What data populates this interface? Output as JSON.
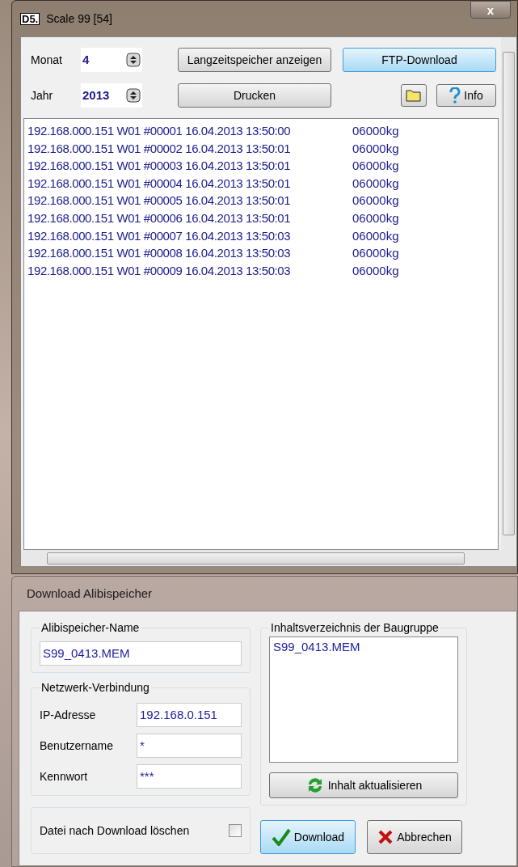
{
  "main_window": {
    "title": "Scale 99 [54]",
    "logo": "D5.",
    "close": "x",
    "month": {
      "label": "Monat",
      "value": "4"
    },
    "year": {
      "label": "Jahr",
      "value": "2013"
    },
    "buttons": [
      {
        "label": "Langzeitspeicher anzeigen",
        "selected": false
      },
      {
        "label": "FTP-Download",
        "selected": true
      },
      {
        "label": "Drucken",
        "selected": false
      }
    ],
    "info_button": "Info",
    "records": [
      {
        "line": "192.168.000.151 W01 #00001 16.04.2013 13:50:00",
        "weight": "06000kg"
      },
      {
        "line": "192.168.000.151 W01 #00002 16.04.2013 13:50:01",
        "weight": "06000kg"
      },
      {
        "line": "192.168.000.151 W01 #00003 16.04.2013 13:50:01",
        "weight": "06000kg"
      },
      {
        "line": "192.168.000.151 W01 #00004 16.04.2013 13:50:01",
        "weight": "06000kg"
      },
      {
        "line": "192.168.000.151 W01 #00005 16.04.2013 13:50:01",
        "weight": "06000kg"
      },
      {
        "line": "192.168.000.151 W01 #00006 16.04.2013 13:50:01",
        "weight": "06000kg"
      },
      {
        "line": "192.168.000.151 W01 #00007 16.04.2013 13:50:03",
        "weight": "06000kg"
      },
      {
        "line": "192.168.000.151 W01 #00008 16.04.2013 13:50:03",
        "weight": "06000kg"
      },
      {
        "line": "192.168.000.151 W01 #00009 16.04.2013 13:50:03",
        "weight": "06000kg"
      }
    ]
  },
  "download_window": {
    "title": "Download Alibispeicher",
    "name_group": {
      "title": "Alibispeicher-Name",
      "value": "S99_0413.MEM"
    },
    "network_group": {
      "title": "Netzwerk-Verbindung",
      "fields": [
        {
          "label": "IP-Adresse",
          "value": "192.168.0.151"
        },
        {
          "label": "Benutzername",
          "value": "*"
        },
        {
          "label": "Kennwort",
          "value": "***"
        }
      ]
    },
    "directory_group": {
      "title": "Inhaltsverzeichnis der Baugruppe",
      "items": [
        "S99_0413.MEM"
      ],
      "refresh_button": "Inhalt aktualisieren"
    },
    "delete_option": {
      "label": "Datei nach Download löschen",
      "checked": false
    },
    "download_button": "Download",
    "cancel_button": "Abbrechen"
  }
}
